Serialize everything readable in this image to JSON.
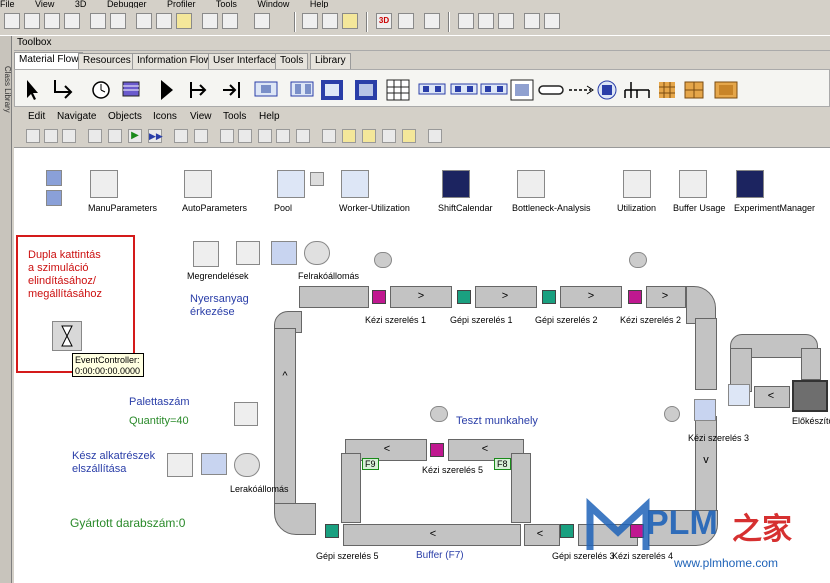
{
  "menu": {
    "items": [
      "File",
      "View",
      "3D",
      "Debugger",
      "Profiler",
      "Tools",
      "Window",
      "Help"
    ]
  },
  "sidebar": {
    "label": "Class Library"
  },
  "toolbox": {
    "title": "Toolbox",
    "tabs": [
      "Material Flow",
      "Resources",
      "Information Flow",
      "User Interface",
      "Tools",
      "Library"
    ]
  },
  "frame_menu": {
    "items": [
      "Edit",
      "Navigate",
      "Objects",
      "Icons",
      "View",
      "Tools",
      "Help"
    ]
  },
  "top_objects": [
    "ManuParameters",
    "AutoParameters",
    "Pool",
    "Worker-Utilization",
    "ShiftCalendar",
    "Bottleneck-Analysis",
    "Utilization",
    "Buffer Usage",
    "ExperimentManager"
  ],
  "note": {
    "lines": [
      "Dupla kattintás",
      "a szimuláció",
      "elindításához/",
      "megállításához"
    ]
  },
  "event_controller": {
    "name": "EventController:",
    "time": "0:00:00:00.0000"
  },
  "source": {
    "orders": "Megrendelések",
    "station": "Felrakóállomás",
    "raw_arrival": [
      "Nyersanyag",
      "érkezése"
    ]
  },
  "stations": {
    "k1": "Kézi szerelés 1",
    "g1": "Gépi szerelés 1",
    "g2": "Gépi szerelés 2",
    "k2": "Kézi szerelés 2",
    "k3": "Kézi szerelés 3",
    "elo": "Előkészítő",
    "k5": "Kézi szerelés 5",
    "g5": "Gépi szerelés 5",
    "g3": "Gépi szerelés 3",
    "k4": "Kézi szerelés 4",
    "buffer": "Buffer (F7)",
    "unload": "Lerakóállomás"
  },
  "pallets": {
    "title": "Palettaszám",
    "quantity": "Quantity=40"
  },
  "test": {
    "title": "Teszt munkahely"
  },
  "finished": {
    "lines": [
      "Kész alkatrészek",
      "elszállítása"
    ]
  },
  "counter": {
    "text": "Gyártott darabszám:0"
  },
  "flags": {
    "f9": "F9",
    "f8": "F8"
  },
  "watermark": {
    "brand": "PLM",
    "cn": "之家",
    "url": "www.plmhome.com"
  }
}
